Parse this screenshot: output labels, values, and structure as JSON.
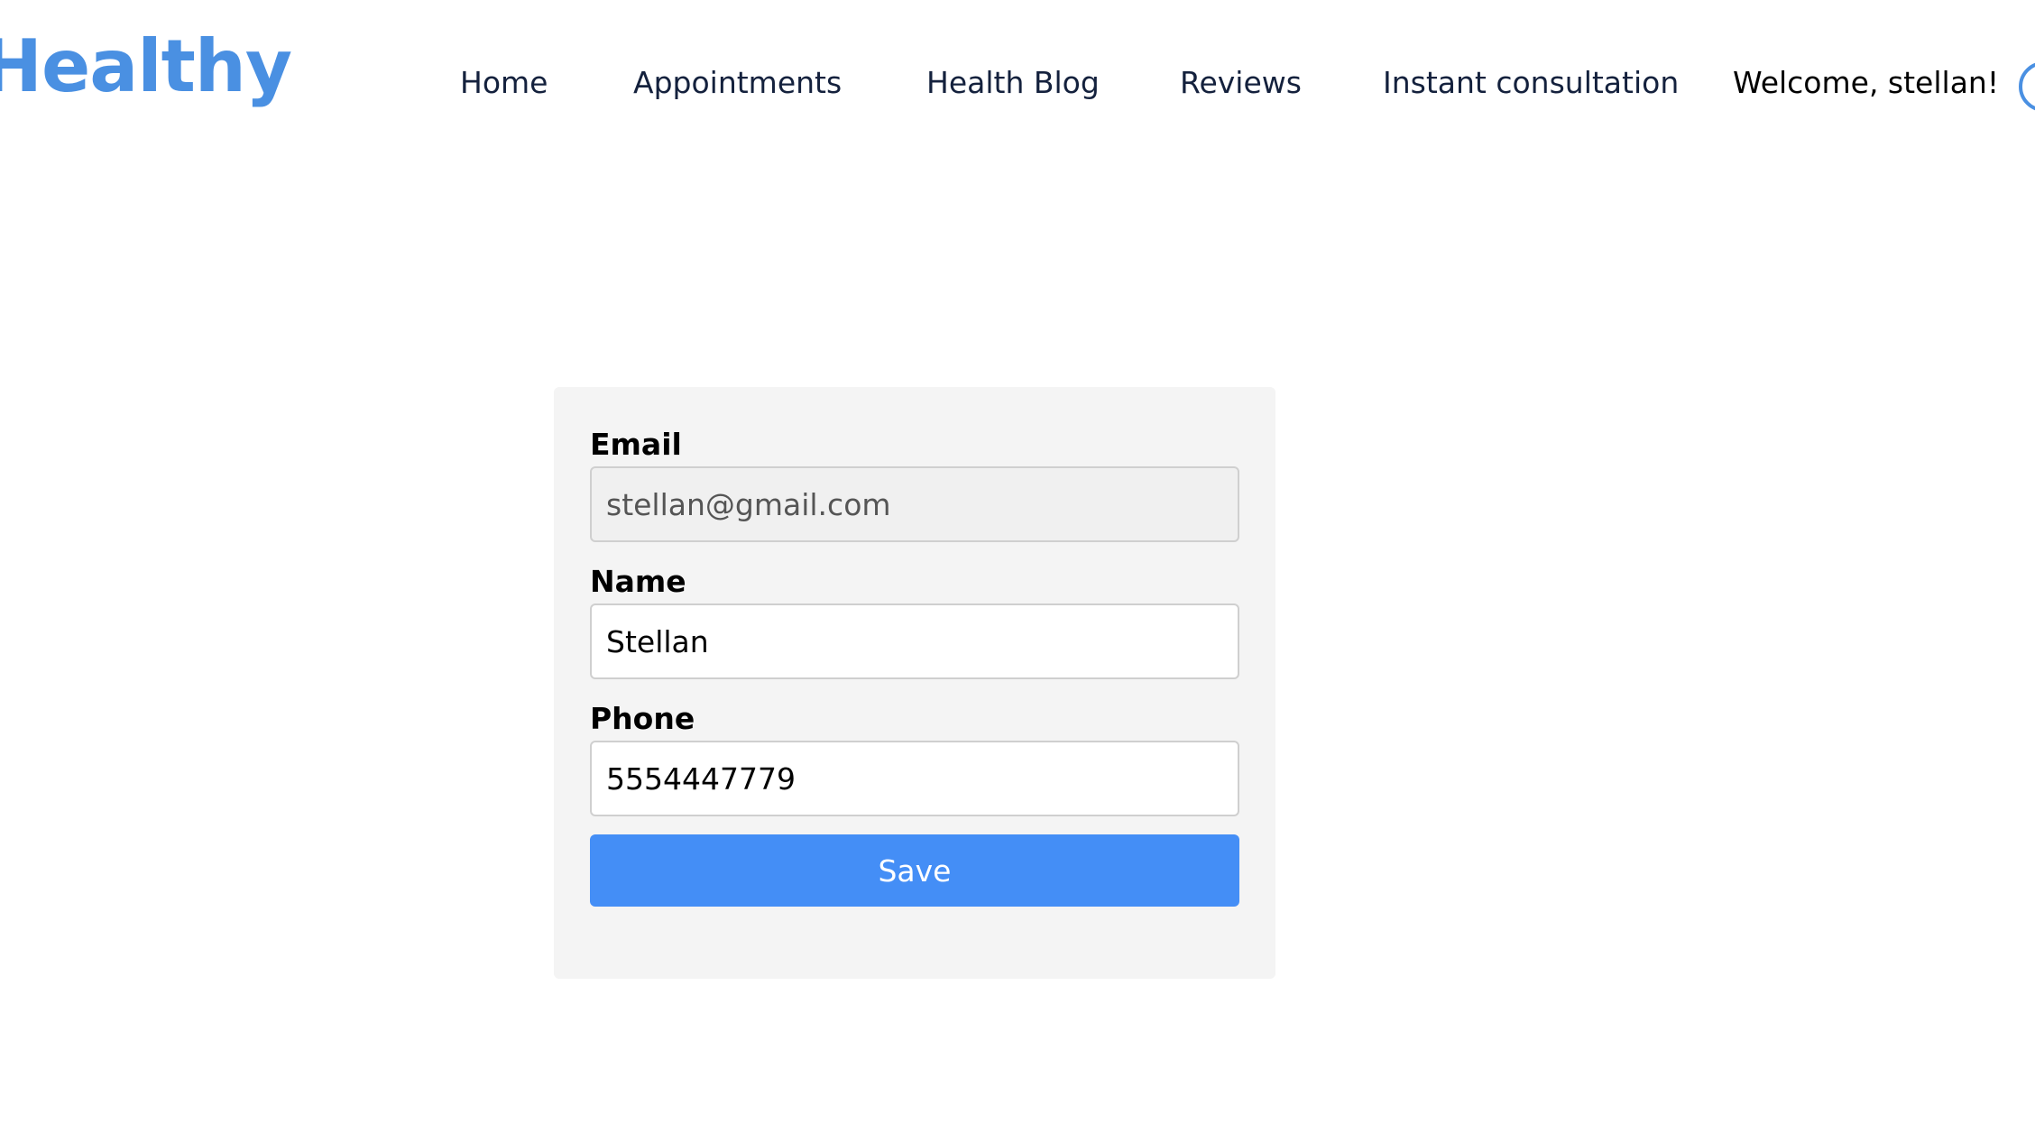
{
  "header": {
    "logo_text": "Healthy",
    "nav": {
      "home": "Home",
      "appointments": "Appointments",
      "health_blog": "Health Blog",
      "reviews": "Reviews",
      "instant_consultation": "Instant consultation"
    },
    "welcome_text": "Welcome, stellan!"
  },
  "profile_form": {
    "email_label": "Email",
    "email_value": "stellan@gmail.com",
    "name_label": "Name",
    "name_value": "Stellan",
    "phone_label": "Phone",
    "phone_value": "5554447779",
    "save_label": "Save"
  },
  "colors": {
    "brand_blue": "#4a90e2",
    "button_blue": "#448ef6",
    "card_background": "#f4f4f4",
    "nav_text": "#14213d"
  }
}
